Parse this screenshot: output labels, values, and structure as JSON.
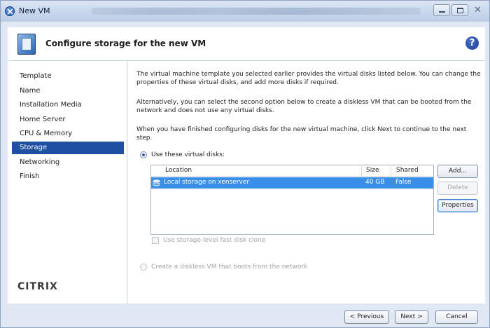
{
  "window": {
    "title": "New VM"
  },
  "header": {
    "title": "Configure storage for the new VM",
    "help_glyph": "?"
  },
  "sidebar": {
    "items": [
      {
        "label": "Template",
        "selected": false
      },
      {
        "label": "Name",
        "selected": false
      },
      {
        "label": "Installation Media",
        "selected": false
      },
      {
        "label": "Home Server",
        "selected": false
      },
      {
        "label": "CPU & Memory",
        "selected": false
      },
      {
        "label": "Storage",
        "selected": true
      },
      {
        "label": "Networking",
        "selected": false
      },
      {
        "label": "Finish",
        "selected": false
      }
    ],
    "logo": "CITRIX"
  },
  "main": {
    "para1": "The virtual machine template you selected earlier provides the virtual disks listed below. You can change the properties of these virtual disks, and add more disks if required.",
    "para2": "Alternatively, you can select the second option below to create a diskless VM that can be booted from the network and does not use any virtual disks.",
    "para3": "When you have finished configuring disks for the new virtual machine, click Next to continue to the next step.",
    "option_use_disks": "Use these virtual disks:",
    "option_diskless": "Create a diskless VM that boots from the network",
    "fast_clone_label": "Use storage-level fast disk clone",
    "table": {
      "columns": [
        "Location",
        "Size",
        "Shared"
      ],
      "rows": [
        {
          "location": "Local storage on xenserver",
          "size": "40 GB",
          "shared": "False"
        }
      ]
    },
    "buttons": {
      "add": "Add...",
      "delete": "Delete",
      "properties": "Properties"
    }
  },
  "footer": {
    "previous": "< Previous",
    "next": "Next >",
    "cancel": "Cancel"
  },
  "colors": {
    "selection": "#1e4fa0",
    "row_highlight": "#3a8ee6"
  }
}
